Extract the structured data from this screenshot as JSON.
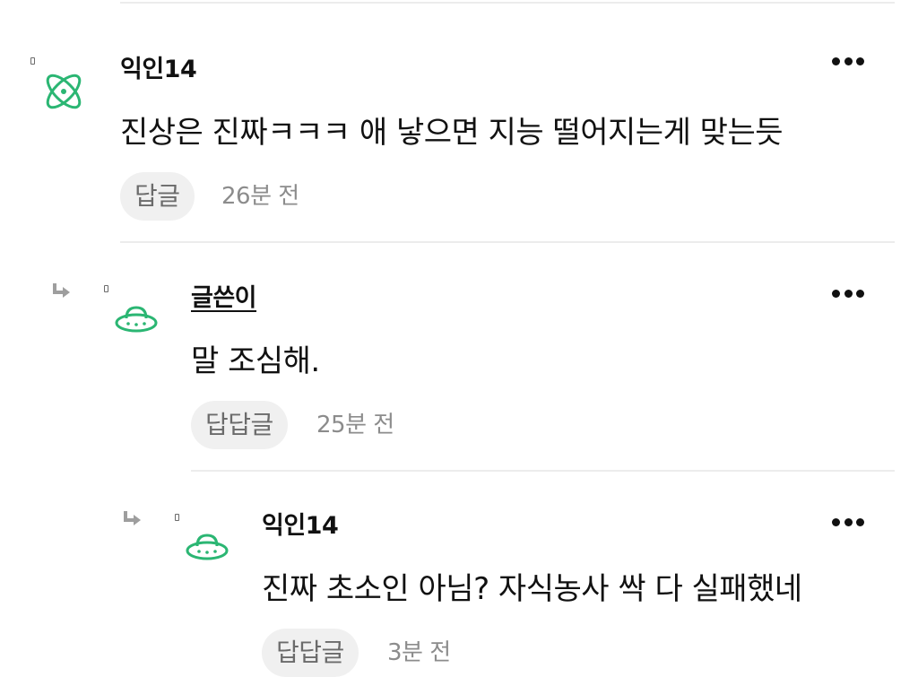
{
  "comments": [
    {
      "author": "익인14",
      "text": "진상은 진짜ㅋㅋㅋ 애 낳으면 지능 떨어지는게 맞는듯",
      "reply_label": "답글",
      "time": "26분 전",
      "avatar_icon": "atom-icon",
      "accent": "#2bb673"
    },
    {
      "author": "글쓴이",
      "text": "말 조심해.",
      "reply_label": "답답글",
      "time": "25분 전",
      "avatar_icon": "ufo-icon",
      "accent": "#2bb673"
    },
    {
      "author": "익인14",
      "text": "진짜 초소인 아님? 자식농사 싹 다 실패했네",
      "reply_label": "답답글",
      "time": "3분 전",
      "avatar_icon": "ufo-icon",
      "accent": "#2bb673"
    }
  ]
}
